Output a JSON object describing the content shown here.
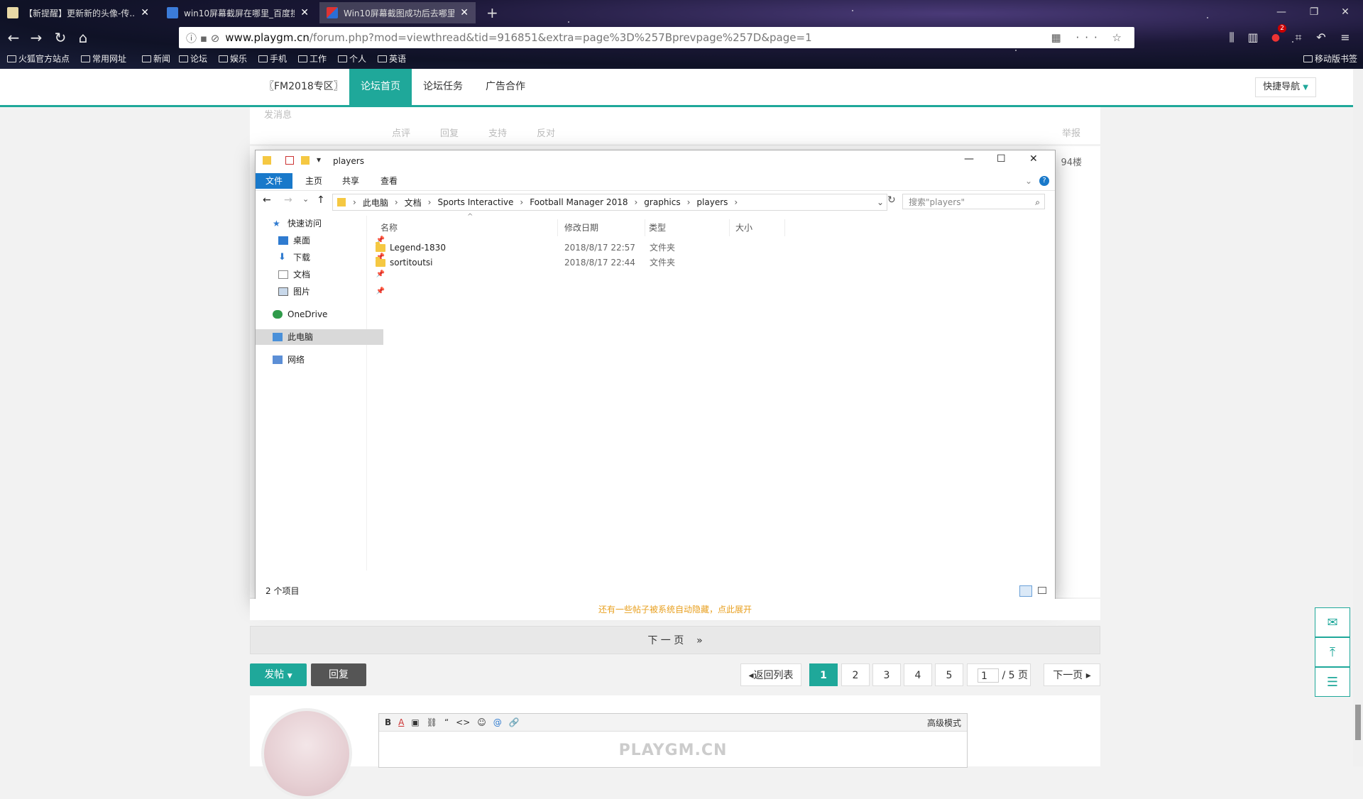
{
  "browser": {
    "tabs": [
      {
        "label": "【新提醒】更新新的头像-传..."
      },
      {
        "label": "win10屏幕截屏在哪里_百度搜..."
      },
      {
        "label": "Win10屏幕截图成功后去哪里找..."
      }
    ],
    "new_tab": "+",
    "url_host": "www.playgm.cn",
    "url_path": "/forum.php?mod=viewthread&tid=916851&extra=page%3D%257Bprevpage%257D&page=1",
    "bookmarks": [
      "火狐官方站点",
      "常用网址",
      "新闻",
      "论坛",
      "娱乐",
      "手机",
      "工作",
      "个人",
      "英语"
    ],
    "mobile_bookmarks": "移动版书签",
    "badge": "2"
  },
  "forum": {
    "nav": [
      "〖FM2018专区〗",
      "论坛首页",
      "论坛任务",
      "广告合作"
    ],
    "quick_nav": "快捷导航",
    "faded_actions": [
      "点评",
      "回复",
      "支持",
      "反对"
    ],
    "report": "举报",
    "send_msg": "发消息",
    "floor": "94楼",
    "hidden_note": "还有一些帖子被系统自动隐藏，点此展开",
    "next_page": "下 一 页",
    "next_arrow": "»",
    "post_btn": "发帖",
    "reply_btn": "回复",
    "back_list": "返回列表",
    "pages": [
      "1",
      "2",
      "3",
      "4",
      "5"
    ],
    "page_input": "1",
    "page_total": "/ 5 页",
    "next_btn": "下一页",
    "editor_tools": [
      "B",
      "A",
      "▣",
      "⛓",
      "“",
      "<>",
      "☺",
      "@",
      "🔗"
    ],
    "advanced_mode": "高级模式",
    "watermark": "PLAYGM.CN"
  },
  "explorer": {
    "title": "players",
    "ribbon_tabs": [
      "文件",
      "主页",
      "共享",
      "查看"
    ],
    "breadcrumb": [
      "此电脑",
      "文档",
      "Sports Interactive",
      "Football Manager 2018",
      "graphics",
      "players"
    ],
    "search_placeholder": "搜索\"players\"",
    "nav_items": [
      {
        "label": "快速访问",
        "icon": "star-icon"
      },
      {
        "label": "桌面",
        "icon": "desktop-icon"
      },
      {
        "label": "下载",
        "icon": "download-icon"
      },
      {
        "label": "文档",
        "icon": "document-icon"
      },
      {
        "label": "图片",
        "icon": "picture-icon"
      },
      {
        "label": "OneDrive",
        "icon": "cloud-icon"
      },
      {
        "label": "此电脑",
        "icon": "computer-icon"
      },
      {
        "label": "网络",
        "icon": "network-icon"
      }
    ],
    "columns": [
      "名称",
      "修改日期",
      "类型",
      "大小"
    ],
    "files": [
      {
        "name": "Legend-1830",
        "date": "2018/8/17 22:57",
        "type": "文件夹"
      },
      {
        "name": "sortitoutsi",
        "date": "2018/8/17 22:44",
        "type": "文件夹"
      }
    ],
    "status": "2 个项目"
  }
}
